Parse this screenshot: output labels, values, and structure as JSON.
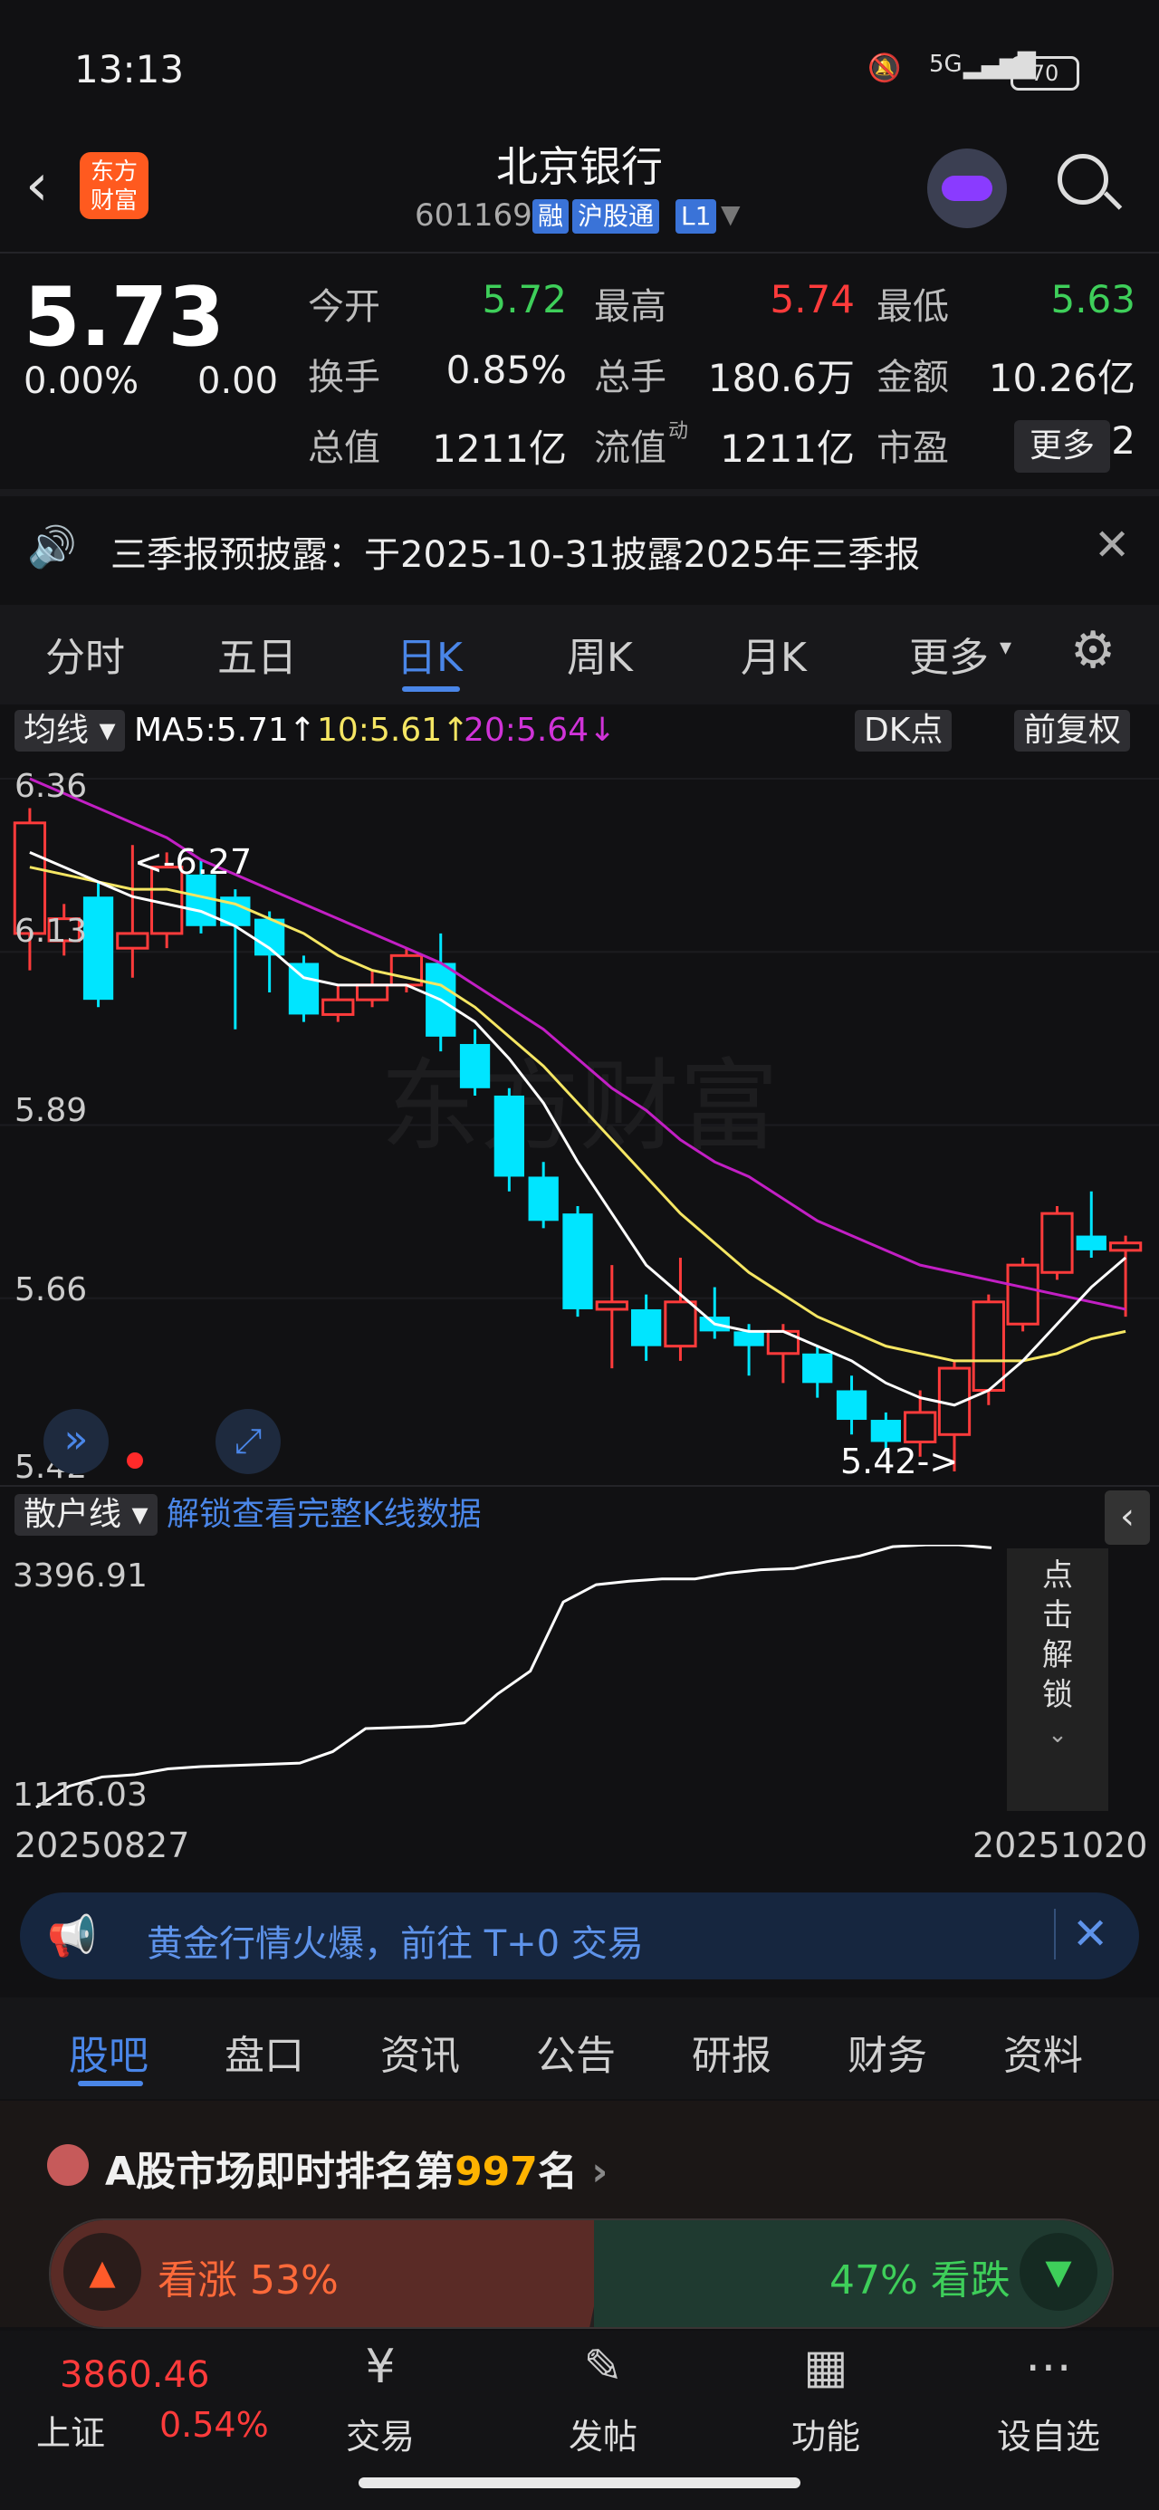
{
  "status": {
    "time": "13:13",
    "network": "5G",
    "battery": "70"
  },
  "header": {
    "title": "北京银行",
    "code": "601169",
    "tags": [
      "融",
      "沪股通",
      "L1"
    ],
    "logo": "东方\n财富"
  },
  "quote": {
    "price": "5.73",
    "change_pct": "0.00%",
    "change": "0.00",
    "rows": [
      [
        {
          "label": "今开",
          "value": "5.72",
          "color": "#3ecf5a"
        },
        {
          "label": "最高",
          "value": "5.74",
          "color": "#ff3b3b"
        },
        {
          "label": "最低",
          "value": "5.63",
          "color": "#3ecf5a"
        }
      ],
      [
        {
          "label": "换手",
          "value": "0.85%",
          "color": "#eeeeee"
        },
        {
          "label": "总手",
          "value": "180.6万",
          "color": "#eeeeee"
        },
        {
          "label": "金额",
          "value": "10.26亿",
          "color": "#eeeeee"
        }
      ],
      [
        {
          "label": "总值",
          "value": "1211亿",
          "color": "#eeeeee"
        },
        {
          "label": "流值",
          "value": "1211亿",
          "color": "#eeeeee"
        },
        {
          "label": "市盈",
          "value": "4.02",
          "color": "#eeeeee"
        }
      ]
    ],
    "pe_superscript": "动",
    "more_label": "更多"
  },
  "notice": {
    "text": "三季报预披露：于2025-10-31披露2025年三季报"
  },
  "period_tabs": [
    "分时",
    "五日",
    "日K",
    "周K",
    "月K",
    "更多"
  ],
  "active_period": 2,
  "kline": {
    "ma_label": "均线",
    "ma5": "MA5:5.71↑",
    "ma10": "10:5.61↑",
    "ma20": "20:5.64↓",
    "dk_label": "DK点",
    "adjust_label": "前复权",
    "y_ticks": [
      "6.36",
      "6.13",
      "5.89",
      "5.66",
      "5.42"
    ],
    "high_annot": "<-6.27",
    "low_annot": "5.42->",
    "watermark": "东方财富"
  },
  "chart_data": {
    "type": "candlestick",
    "ylim": [
      5.42,
      6.36
    ],
    "candles": [
      {
        "o": 6.15,
        "c": 6.3,
        "h": 6.32,
        "l": 6.1
      },
      {
        "o": 6.14,
        "c": 6.17,
        "h": 6.19,
        "l": 6.12
      },
      {
        "o": 6.2,
        "c": 6.06,
        "h": 6.22,
        "l": 6.05
      },
      {
        "o": 6.13,
        "c": 6.15,
        "h": 6.27,
        "l": 6.09
      },
      {
        "o": 6.15,
        "c": 6.24,
        "h": 6.26,
        "l": 6.13
      },
      {
        "o": 6.23,
        "c": 6.16,
        "h": 6.25,
        "l": 6.15
      },
      {
        "o": 6.2,
        "c": 6.16,
        "h": 6.21,
        "l": 6.02
      },
      {
        "o": 6.17,
        "c": 6.12,
        "h": 6.18,
        "l": 6.07
      },
      {
        "o": 6.11,
        "c": 6.04,
        "h": 6.12,
        "l": 6.03
      },
      {
        "o": 6.04,
        "c": 6.06,
        "h": 6.08,
        "l": 6.03
      },
      {
        "o": 6.06,
        "c": 6.08,
        "h": 6.1,
        "l": 6.05
      },
      {
        "o": 6.08,
        "c": 6.12,
        "h": 6.13,
        "l": 6.07
      },
      {
        "o": 6.11,
        "c": 6.01,
        "h": 6.15,
        "l": 5.99
      },
      {
        "o": 6.0,
        "c": 5.94,
        "h": 6.02,
        "l": 5.93
      },
      {
        "o": 5.93,
        "c": 5.82,
        "h": 5.94,
        "l": 5.8
      },
      {
        "o": 5.82,
        "c": 5.76,
        "h": 5.84,
        "l": 5.75
      },
      {
        "o": 5.77,
        "c": 5.64,
        "h": 5.78,
        "l": 5.63
      },
      {
        "o": 5.64,
        "c": 5.65,
        "h": 5.7,
        "l": 5.56
      },
      {
        "o": 5.64,
        "c": 5.59,
        "h": 5.66,
        "l": 5.57
      },
      {
        "o": 5.59,
        "c": 5.65,
        "h": 5.71,
        "l": 5.57
      },
      {
        "o": 5.63,
        "c": 5.61,
        "h": 5.67,
        "l": 5.6
      },
      {
        "o": 5.61,
        "c": 5.59,
        "h": 5.62,
        "l": 5.55
      },
      {
        "o": 5.58,
        "c": 5.61,
        "h": 5.62,
        "l": 5.54
      },
      {
        "o": 5.58,
        "c": 5.54,
        "h": 5.59,
        "l": 5.52
      },
      {
        "o": 5.53,
        "c": 5.49,
        "h": 5.55,
        "l": 5.47
      },
      {
        "o": 5.49,
        "c": 5.46,
        "h": 5.5,
        "l": 5.45
      },
      {
        "o": 5.46,
        "c": 5.5,
        "h": 5.53,
        "l": 5.44
      },
      {
        "o": 5.47,
        "c": 5.56,
        "h": 5.57,
        "l": 5.42
      },
      {
        "o": 5.53,
        "c": 5.65,
        "h": 5.66,
        "l": 5.51
      },
      {
        "o": 5.62,
        "c": 5.7,
        "h": 5.71,
        "l": 5.61
      },
      {
        "o": 5.69,
        "c": 5.77,
        "h": 5.78,
        "l": 5.68
      },
      {
        "o": 5.74,
        "c": 5.72,
        "h": 5.8,
        "l": 5.71
      },
      {
        "o": 5.72,
        "c": 5.73,
        "h": 5.74,
        "l": 5.63
      }
    ],
    "ma5": [
      6.26,
      6.24,
      6.22,
      6.2,
      6.19,
      6.18,
      6.16,
      6.13,
      6.09,
      6.08,
      6.08,
      6.08,
      6.06,
      6.03,
      5.98,
      5.92,
      5.84,
      5.77,
      5.7,
      5.66,
      5.62,
      5.61,
      5.61,
      5.59,
      5.57,
      5.54,
      5.52,
      5.51,
      5.53,
      5.57,
      5.62,
      5.67,
      5.71
    ],
    "ma10": [
      6.24,
      6.23,
      6.22,
      6.21,
      6.21,
      6.2,
      6.19,
      6.17,
      6.15,
      6.12,
      6.1,
      6.09,
      6.08,
      6.05,
      6.01,
      5.97,
      5.92,
      5.87,
      5.82,
      5.77,
      5.73,
      5.69,
      5.66,
      5.63,
      5.61,
      5.59,
      5.58,
      5.57,
      5.57,
      5.57,
      5.58,
      5.6,
      5.61
    ],
    "ma20": [
      6.36,
      6.34,
      6.32,
      6.3,
      6.28,
      6.25,
      6.23,
      6.21,
      6.19,
      6.17,
      6.15,
      6.13,
      6.11,
      6.08,
      6.05,
      6.02,
      5.98,
      5.94,
      5.91,
      5.87,
      5.84,
      5.82,
      5.79,
      5.76,
      5.74,
      5.72,
      5.7,
      5.69,
      5.68,
      5.67,
      5.66,
      5.65,
      5.64
    ]
  },
  "retail": {
    "label": "散户线",
    "unlock_text": "解锁查看完整K线数据",
    "y_top": "3396.91",
    "y_bottom": "1116.03",
    "values": [
      1116,
      1300,
      1380,
      1400,
      1450,
      1470,
      1480,
      1490,
      1500,
      1600,
      1800,
      1810,
      1820,
      1850,
      2100,
      2300,
      2900,
      3050,
      3080,
      3100,
      3100,
      3150,
      3180,
      3190,
      3250,
      3300,
      3380,
      3396,
      3396,
      3370
    ],
    "side_text": "点\n击\n解\n锁",
    "date_start": "20250827",
    "date_end": "20251020"
  },
  "banner": {
    "text": "黄金行情火爆，前往 T+0 交易"
  },
  "subtabs": [
    "股吧",
    "盘口",
    "资讯",
    "公告",
    "研报",
    "财务",
    "资料"
  ],
  "rank": {
    "prefix": "A股市场即时排名第",
    "num": "997",
    "suffix": "名"
  },
  "vote": {
    "up_label": "看涨 53%",
    "down_label": "47% 看跌"
  },
  "bottom": {
    "index_value": "3860.46",
    "index_name": "上证",
    "index_change": "0.54%",
    "nav": [
      "交易",
      "发帖",
      "功能",
      "设自选"
    ]
  },
  "colors": {
    "up": "#ff3b3b",
    "down": "#00e5ff",
    "ma5": "#ffffff",
    "ma10": "#f5e663",
    "ma20": "#c21fc4",
    "accent": "#4a86e8"
  }
}
